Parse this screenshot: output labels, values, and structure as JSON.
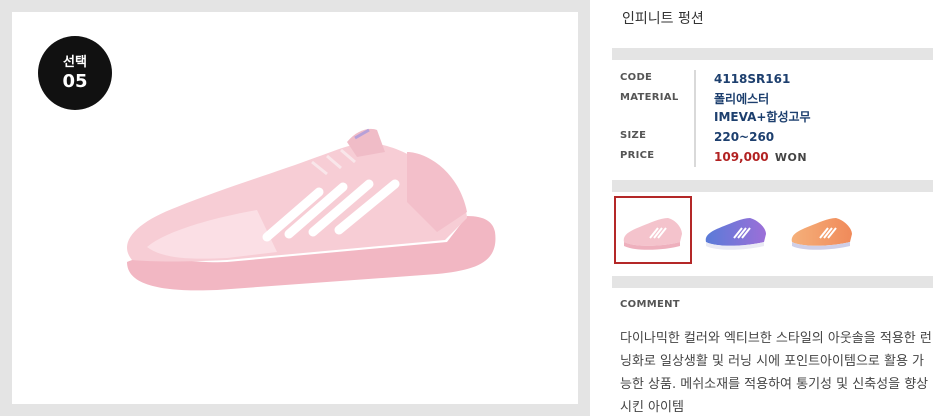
{
  "badge": {
    "line1": "선택",
    "line2": "05"
  },
  "product": {
    "title": "인피니트 펑션",
    "specs": {
      "code_label": "CODE",
      "code_value": "4118SR161",
      "material_label": "MATERIAL",
      "material_value_1": "폴리에스터",
      "material_value_2": "IMEVA+합성고무",
      "size_label": "SIZE",
      "size_value": "220~260",
      "price_label": "PRICE",
      "price_value": "109,000",
      "price_currency": "WON"
    },
    "thumbnails": [
      {
        "color": "pink",
        "selected": true
      },
      {
        "color": "blue-purple",
        "selected": false
      },
      {
        "color": "orange",
        "selected": false
      }
    ],
    "comment_label": "COMMENT",
    "comment_text": "다이나믹한 컬러와 엑티브한 스타일의 아웃솔을 적용한 런닝화로 일상생활 및 러닝 시에 포인트아이템으로 활용 가능한 상품. 메쉬소재를 적용하여 통기성 및 신축성을 향상시킨 아이템"
  },
  "colors": {
    "accent_blue": "#1d3f6e",
    "price_red": "#b22222",
    "selected_border": "#b42828",
    "panel_gray": "#e4e4e4",
    "shoe_pink": "#f4c3cc"
  }
}
